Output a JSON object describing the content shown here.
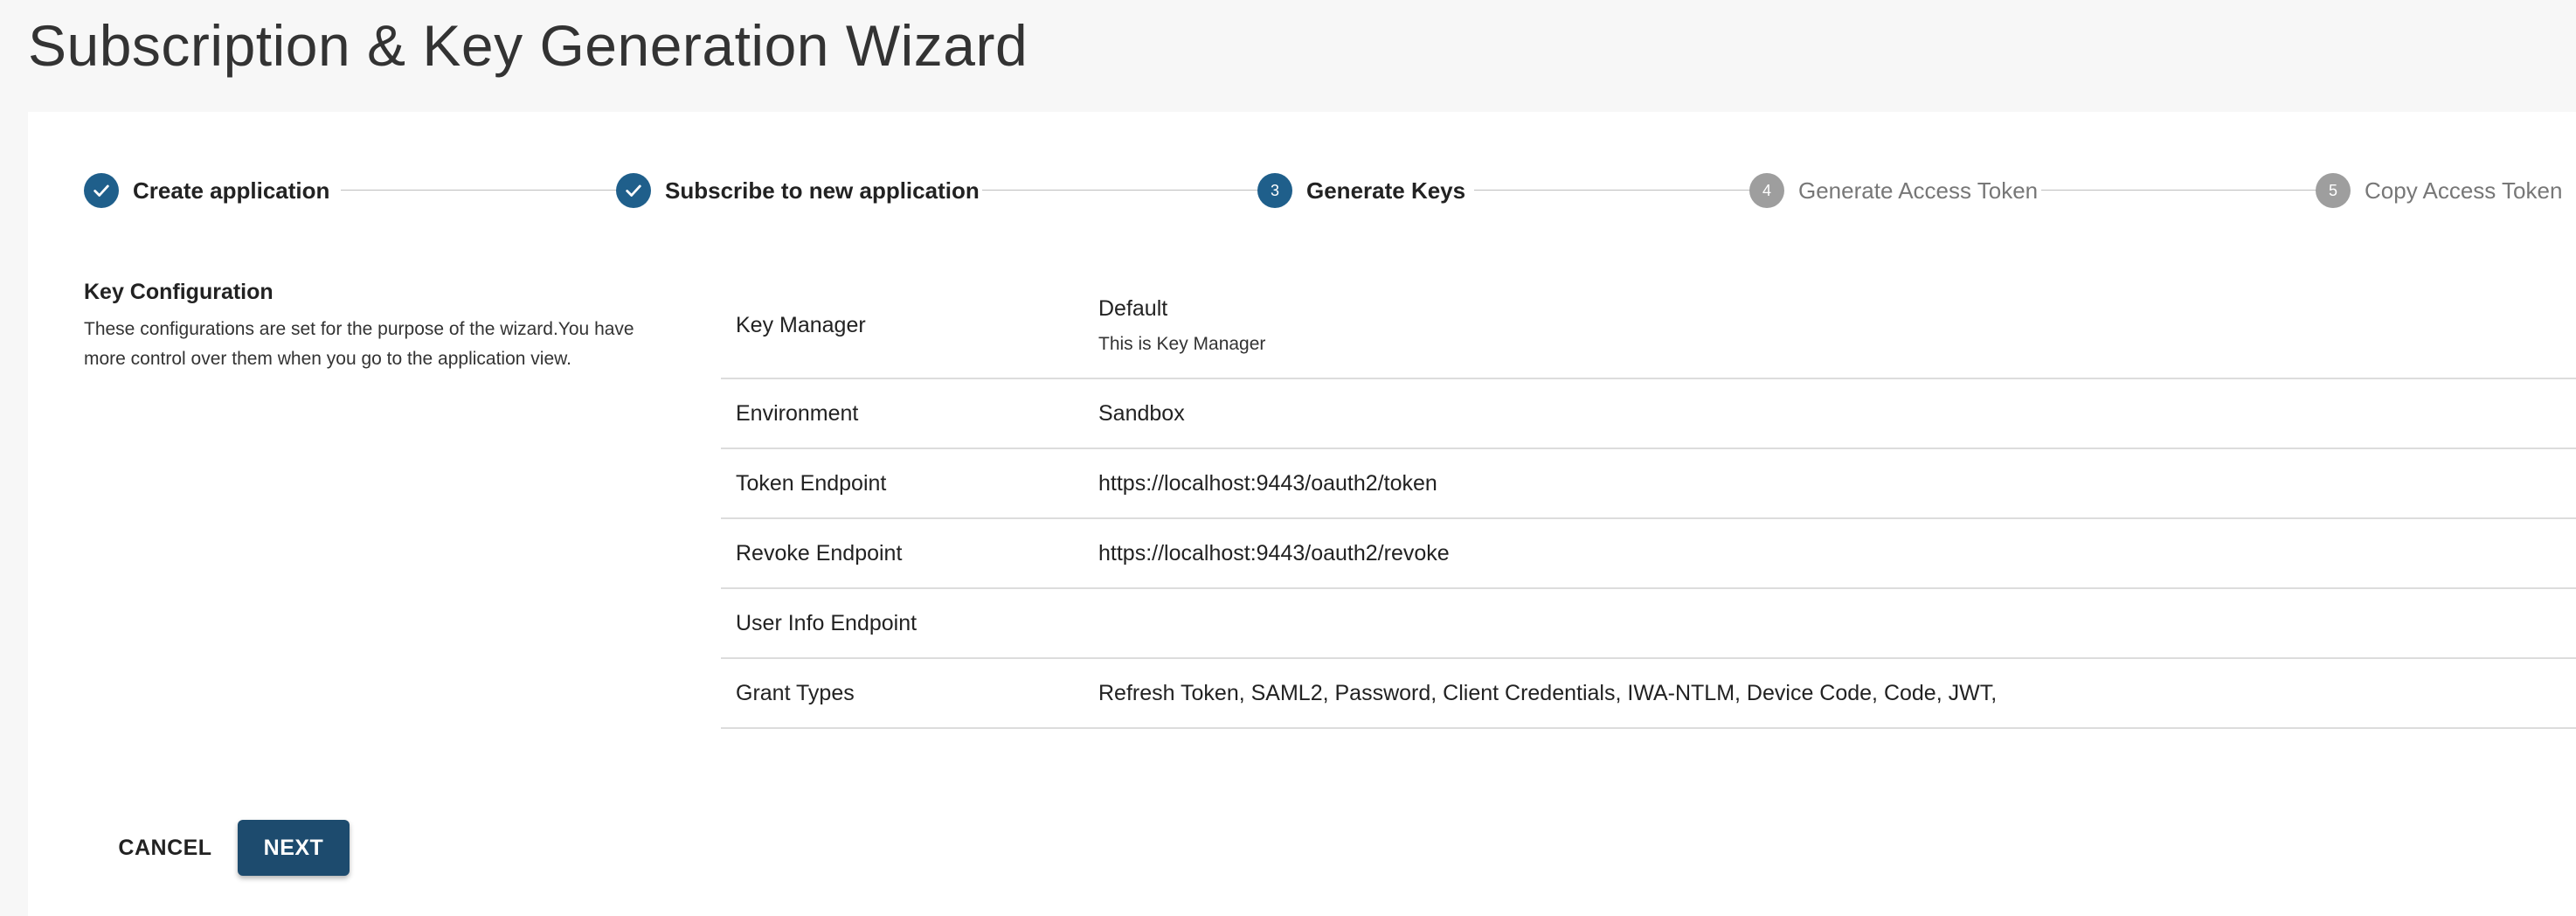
{
  "page": {
    "title": "Subscription & Key Generation Wizard"
  },
  "stepper": {
    "steps": [
      {
        "label": "Create application",
        "status": "completed",
        "number": "1"
      },
      {
        "label": "Subscribe to new application",
        "status": "completed",
        "number": "2"
      },
      {
        "label": "Generate Keys",
        "status": "active",
        "number": "3"
      },
      {
        "label": "Generate Access Token",
        "status": "pending",
        "number": "4"
      },
      {
        "label": "Copy Access Token",
        "status": "pending",
        "number": "5"
      }
    ],
    "check_icon": "check-icon"
  },
  "key_config": {
    "title": "Key Configuration",
    "description": "These configurations are set for the purpose of the wizard.You have more control over them when you go to the application view.",
    "rows": [
      {
        "key": "Key Manager",
        "value": "Default",
        "sub": "This is Key Manager"
      },
      {
        "key": "Environment",
        "value": "Sandbox"
      },
      {
        "key": "Token Endpoint",
        "value": "https://localhost:9443/oauth2/token"
      },
      {
        "key": "Revoke Endpoint",
        "value": "https://localhost:9443/oauth2/revoke"
      },
      {
        "key": "User Info Endpoint",
        "value": ""
      },
      {
        "key": "Grant Types",
        "value": "Refresh Token, SAML2, Password, Client Credentials, IWA-NTLM, Device Code, Code, JWT,"
      }
    ]
  },
  "actions": {
    "cancel_label": "CANCEL",
    "next_label": "NEXT"
  },
  "colors": {
    "step_active": "#1f5f8b",
    "step_pending": "#9e9e9e",
    "primary_button": "#1d4b6e"
  }
}
